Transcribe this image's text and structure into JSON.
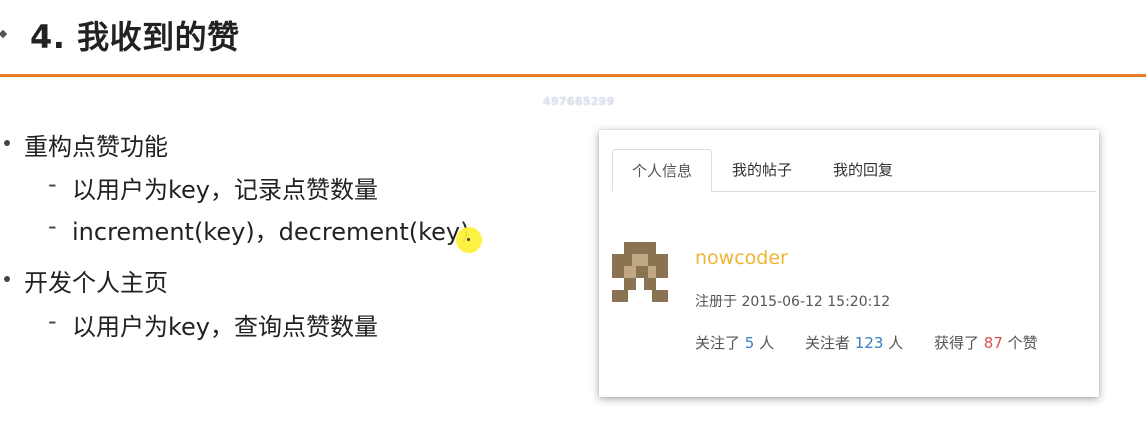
{
  "slide": {
    "title": "4. 我收到的赞",
    "watermark": "497665299",
    "bullets": [
      {
        "text": "重构点赞功能",
        "sub": [
          "以用户为key，记录点赞数量",
          "increment(key)，decrement(key)"
        ]
      },
      {
        "text": "开发个人主页",
        "sub": [
          "以用户为key，查询点赞数量"
        ]
      }
    ],
    "dash": "-"
  },
  "profile_card": {
    "tabs": [
      {
        "label": "个人信息",
        "active": true
      },
      {
        "label": "我的帖子",
        "active": false
      },
      {
        "label": "我的回复",
        "active": false
      }
    ],
    "username": "nowcoder",
    "register_prefix": "注册于",
    "register_time": "2015-06-12 15:20:12",
    "stats": {
      "following_prefix": "关注了",
      "following_count": "5",
      "following_suffix": "人",
      "followers_prefix": "关注者",
      "followers_count": "123",
      "followers_suffix": "人",
      "likes_prefix": "获得了",
      "likes_count": "87",
      "likes_suffix": "个赞"
    },
    "colors": {
      "username": "#f0b433",
      "count_blue": "#3a7cc5",
      "count_red": "#d9534f",
      "accent_rule": "#e97d2a"
    }
  }
}
